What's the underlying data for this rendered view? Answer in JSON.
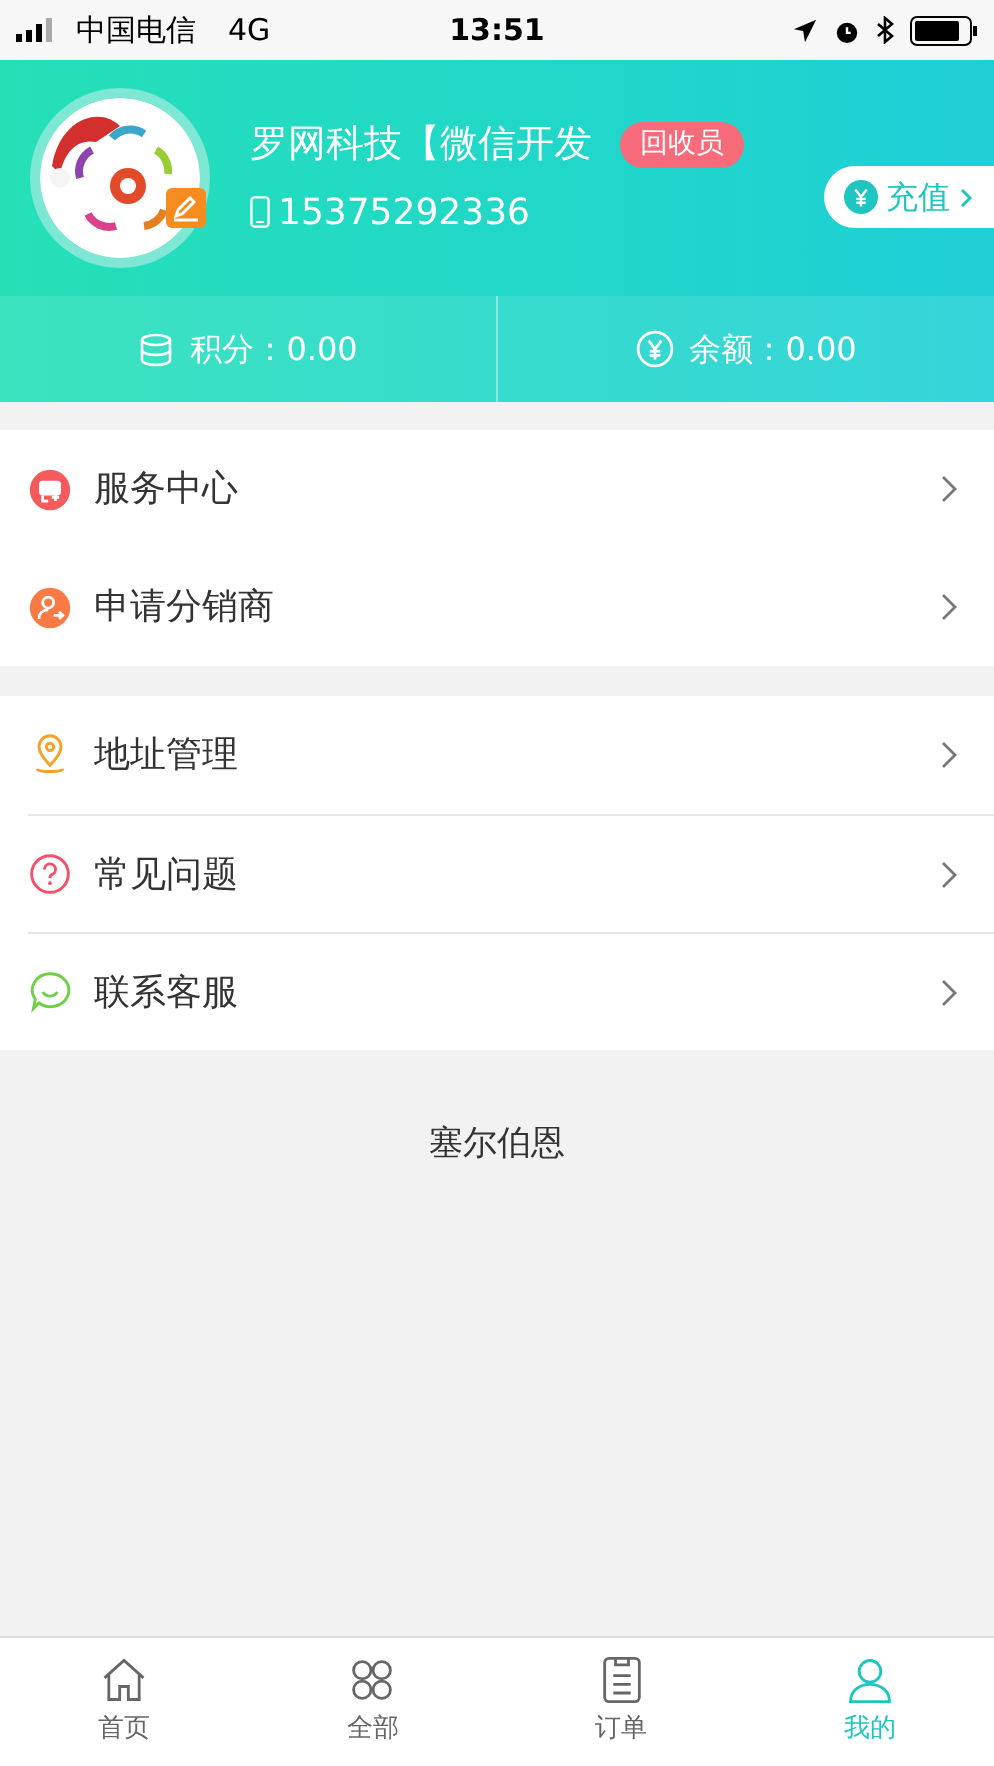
{
  "status_bar": {
    "carrier": "中国电信",
    "network": "4G",
    "time": "13:51"
  },
  "profile": {
    "name": "罗网科技【微信开发",
    "badge": "回收员",
    "phone": "15375292336",
    "recharge": "充值"
  },
  "stats": [
    {
      "kind": "points",
      "label": "积分：0.00"
    },
    {
      "kind": "balance",
      "label": "余额：0.00"
    }
  ],
  "menu_groups": [
    [
      {
        "kind": "service",
        "label": "服务中心",
        "color": "#f55b5b"
      },
      {
        "kind": "distributor",
        "label": "申请分销商",
        "color": "#f97a45"
      }
    ],
    [
      {
        "kind": "address",
        "label": "地址管理",
        "color": "#f7a02a"
      },
      {
        "kind": "faq",
        "label": "常见问题",
        "color": "#f2516a"
      },
      {
        "kind": "contact",
        "label": "联系客服",
        "color": "#6fcf47"
      }
    ]
  ],
  "footer": "塞尔伯恩",
  "tabs": [
    {
      "kind": "home",
      "label": "首页",
      "selected": false
    },
    {
      "kind": "all",
      "label": "全部",
      "selected": false
    },
    {
      "kind": "orders",
      "label": "订单",
      "selected": false
    },
    {
      "kind": "me",
      "label": "我的",
      "selected": true
    }
  ]
}
